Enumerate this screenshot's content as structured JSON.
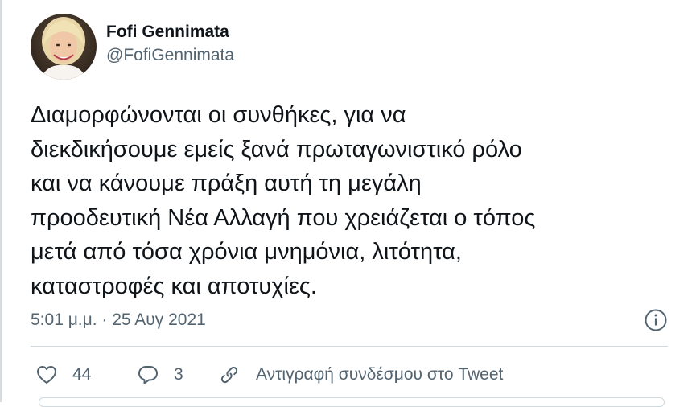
{
  "user": {
    "display_name": "Fofi Gennimata",
    "handle": "@FofiGennimata"
  },
  "tweet": {
    "text": "Διαμορφώνονται οι συνθήκες, για να\nδιεκδικήσουμε εμείς ξανά πρωταγωνιστικό ρόλο\nκαι να κάνουμε πράξη αυτή τη μεγάλη\nπροοδευτική Νέα Αλλαγή που χρειάζεται ο τόπος\nμετά από τόσα χρόνια μνημόνια, λιτότητα,\nκαταστροφές και αποτυχίες.",
    "timestamp": "5:01 μ.μ. · 25 Αυγ 2021"
  },
  "actions": {
    "like_count": "44",
    "reply_count": "3",
    "copy_link_label": "Αντιγραφή συνδέσμου στο Tweet"
  },
  "icons": {
    "info": "info-icon",
    "like": "heart-icon",
    "reply": "speech-bubble-icon",
    "copy_link": "link-icon"
  },
  "colors": {
    "text_primary": "#0f1419",
    "text_secondary": "#536471",
    "divider": "#cfd9de"
  }
}
